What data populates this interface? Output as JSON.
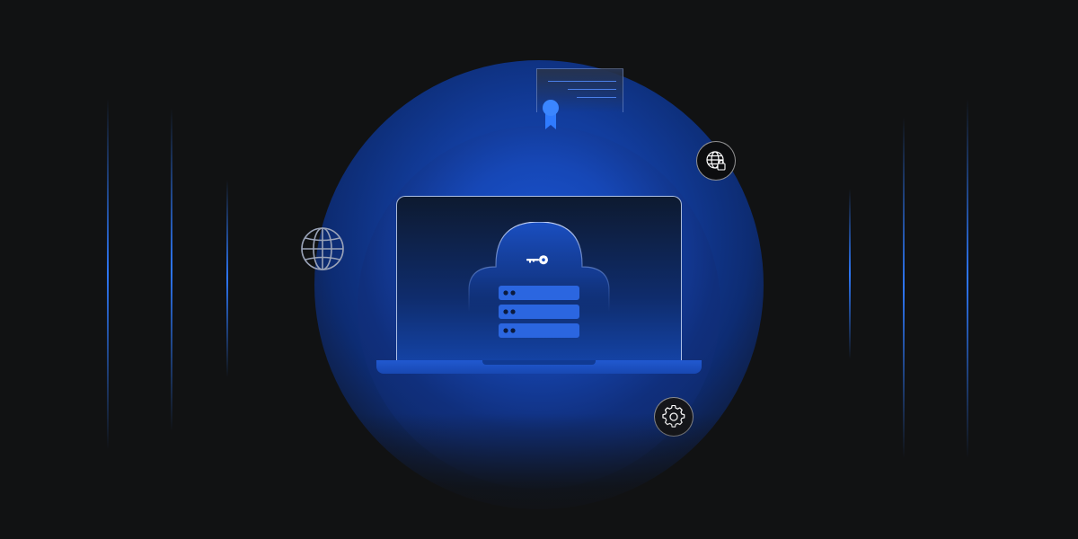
{
  "colors": {
    "background": "#111213",
    "accent_blue": "#1a55d4",
    "bright_blue": "#2f7bff",
    "outline_white": "#e6ecf7"
  },
  "icons": {
    "certificate": "certificate-icon",
    "award_ribbon": "award-ribbon-icon",
    "globe_lock": "globe-lock-icon",
    "globe": "globe-icon",
    "gear": "gear-icon",
    "cloud": "cloud-icon",
    "key": "key-icon",
    "server": "server-stack-icon",
    "laptop": "laptop-icon"
  }
}
